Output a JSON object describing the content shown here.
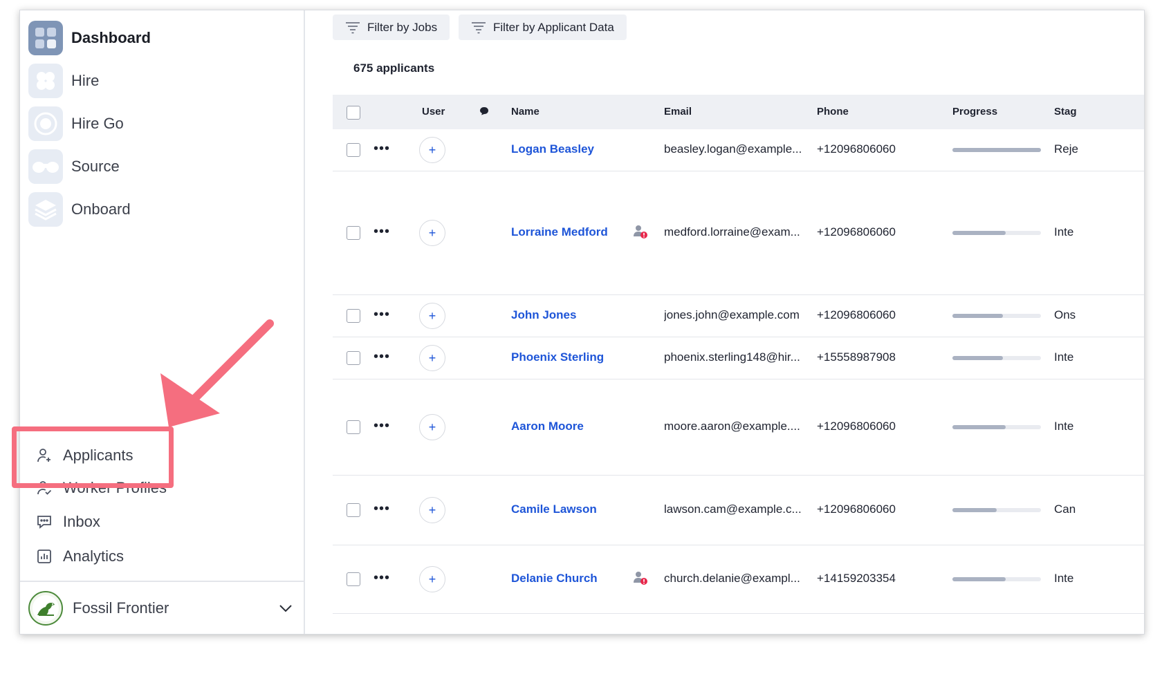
{
  "sidebar": {
    "apps": [
      {
        "label": "Dashboard",
        "icon": "dashboard-grid-icon",
        "active": true
      },
      {
        "label": "Hire",
        "icon": "hire-flower-icon",
        "active": false
      },
      {
        "label": "Hire Go",
        "icon": "hire-go-circle-icon",
        "active": false
      },
      {
        "label": "Source",
        "icon": "source-binoculars-icon",
        "active": false
      },
      {
        "label": "Onboard",
        "icon": "onboard-layers-icon",
        "active": false
      }
    ],
    "nav": [
      {
        "label": "Applicants",
        "icon": "user-plus-icon"
      },
      {
        "label": "Worker Profiles",
        "icon": "user-check-icon"
      },
      {
        "label": "Inbox",
        "icon": "chat-bubble-icon"
      },
      {
        "label": "Analytics",
        "icon": "bar-chart-icon"
      }
    ],
    "org": {
      "name": "Fossil Frontier",
      "icon": "dinosaur-logo-icon"
    }
  },
  "toolbar": {
    "filter_jobs": "Filter by Jobs",
    "filter_applicant_data": "Filter by Applicant Data"
  },
  "summary": {
    "count_label": "675 applicants"
  },
  "table": {
    "columns": {
      "user": "User",
      "name": "Name",
      "email": "Email",
      "phone": "Phone",
      "progress": "Progress",
      "stage": "Stag"
    },
    "rows": [
      {
        "name": "Logan Beasley",
        "email": "beasley.logan@example...",
        "phone": "+12096806060",
        "progress": 1.0,
        "stage": "Reje",
        "flag": false
      },
      {
        "name": "Lorraine Medford",
        "email": "medford.lorraine@exam...",
        "phone": "+12096806060",
        "progress": 0.6,
        "stage": "Inte",
        "flag": true
      },
      {
        "name": "John Jones",
        "email": "jones.john@example.com",
        "phone": "+12096806060",
        "progress": 0.57,
        "stage": "Ons",
        "flag": false
      },
      {
        "name": "Phoenix Sterling",
        "email": "phoenix.sterling148@hir...",
        "phone": "+15558987908",
        "progress": 0.57,
        "stage": "Inte",
        "flag": false
      },
      {
        "name": "Aaron Moore",
        "email": "moore.aaron@example....",
        "phone": "+12096806060",
        "progress": 0.6,
        "stage": "Inte",
        "flag": false
      },
      {
        "name": "Camile Lawson",
        "email": "lawson.cam@example.c...",
        "phone": "+12096806060",
        "progress": 0.5,
        "stage": "Can",
        "flag": false
      },
      {
        "name": "Delanie Church",
        "email": "church.delanie@exampl...",
        "phone": "+14159203354",
        "progress": 0.6,
        "stage": "Inte",
        "flag": true
      }
    ]
  },
  "colors": {
    "accent": "#1e55d8",
    "highlight": "#f56e7f"
  }
}
